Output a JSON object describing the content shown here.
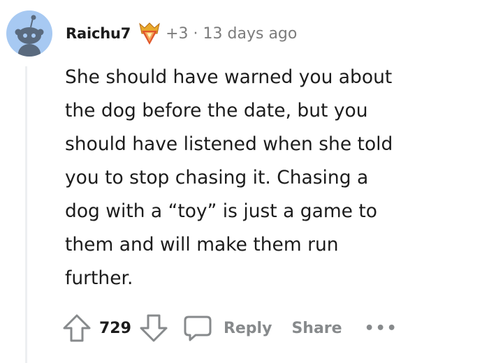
{
  "comment": {
    "author": "Raichu7",
    "award_count": "+3",
    "separator": "·",
    "timestamp": "13 days ago",
    "body_lines": [
      "She should have warned you about",
      "the dog before the date, but you",
      "should have listened when she told",
      "you to stop chasing it. Chasing a",
      "dog with a “toy” is just a game to",
      "them and will make them run",
      "further."
    ],
    "score": "729"
  },
  "actions": {
    "reply_label": "Reply",
    "share_label": "Share",
    "more_label": "•••"
  },
  "icons": {
    "avatar": "snoo-avatar-icon",
    "award": "award-icon",
    "upvote": "upvote-arrow-icon",
    "downvote": "downvote-arrow-icon",
    "reply": "comment-bubble-icon"
  },
  "colors": {
    "avatar_bg": "#a7c9f2",
    "text": "#1c1c1c",
    "muted": "#7c7c7c",
    "action_grey": "#878a8c"
  }
}
